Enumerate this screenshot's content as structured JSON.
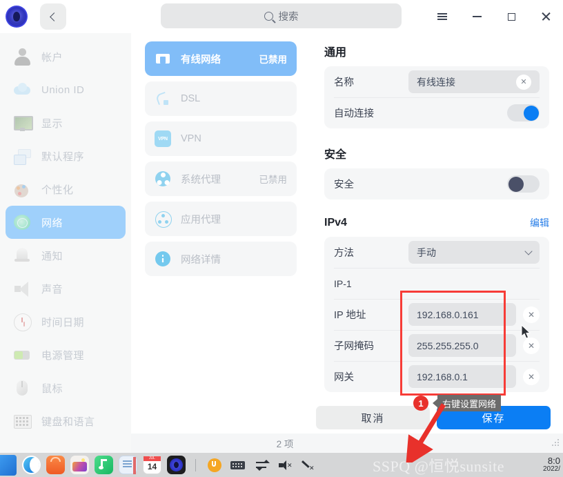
{
  "titlebar": {
    "back_tooltip": "返回",
    "search_placeholder": "搜索",
    "menu_icon": "hamburger-menu-icon",
    "minimize_icon": "minimize-icon",
    "maximize_icon": "maximize-icon",
    "close_icon": "close-icon"
  },
  "sidebar": {
    "items": [
      {
        "label": "帐户",
        "icon": "account-icon",
        "active": false
      },
      {
        "label": "Union ID",
        "icon": "cloud-icon",
        "active": false
      },
      {
        "label": "显示",
        "icon": "display-icon",
        "active": false
      },
      {
        "label": "默认程序",
        "icon": "default-apps-icon",
        "active": false
      },
      {
        "label": "个性化",
        "icon": "personalization-icon",
        "active": false
      },
      {
        "label": "网络",
        "icon": "network-icon",
        "active": true
      },
      {
        "label": "通知",
        "icon": "bell-icon",
        "active": false
      },
      {
        "label": "声音",
        "icon": "speaker-icon",
        "active": false
      },
      {
        "label": "时间日期",
        "icon": "clock-icon",
        "active": false
      },
      {
        "label": "电源管理",
        "icon": "battery-icon",
        "active": false
      },
      {
        "label": "鼠标",
        "icon": "mouse-icon",
        "active": false
      },
      {
        "label": "键盘和语言",
        "icon": "keyboard-icon",
        "active": false
      }
    ]
  },
  "network_list": {
    "items": [
      {
        "label": "有线网络",
        "status": "已禁用",
        "icon": "wired-network-icon",
        "active": true
      },
      {
        "label": "DSL",
        "status": "",
        "icon": "dsl-icon",
        "active": false
      },
      {
        "label": "VPN",
        "status": "",
        "icon": "vpn-icon",
        "active": false
      },
      {
        "label": "系统代理",
        "status": "已禁用",
        "icon": "system-proxy-icon",
        "active": false
      },
      {
        "label": "应用代理",
        "status": "",
        "icon": "app-proxy-icon",
        "active": false
      },
      {
        "label": "网络详情",
        "status": "",
        "icon": "info-icon",
        "active": false
      }
    ]
  },
  "detail": {
    "general": {
      "title": "通用",
      "name_label": "名称",
      "name_value": "有线连接",
      "autoconnect_label": "自动连接",
      "autoconnect_on": true
    },
    "security": {
      "title": "安全",
      "security_label": "安全",
      "security_on": false
    },
    "ipv4": {
      "title": "IPv4",
      "edit_label": "编辑",
      "method_label": "方法",
      "method_value": "手动",
      "group_label": "IP-1",
      "ip_label": "IP 地址",
      "ip_value": "192.168.0.161",
      "netmask_label": "子网掩码",
      "netmask_value": "255.255.255.0",
      "gateway_label": "网关",
      "gateway_value": "192.168.0.1"
    }
  },
  "actions": {
    "cancel_label": "取消",
    "save_label": "保存"
  },
  "statusbar": {
    "count_text": "2 项"
  },
  "annotation": {
    "badge_number": "1",
    "tooltip_text": "右键设置网络",
    "box_color": "#f73c37",
    "badge_color": "#e8312b",
    "tooltip_bg": "#6b6b6b"
  },
  "taskbar": {
    "dock_icons": [
      "files-icon",
      "browser-icon",
      "app-store-icon",
      "gallery-icon",
      "music-icon",
      "notes-icon",
      "calendar-icon",
      "settings-icon"
    ],
    "calendar_day": "14",
    "calendar_month": "JUL",
    "tray_icons": [
      "union-icon",
      "keyboard-input-icon",
      "network-transfer-icon",
      "volume-mute-icon",
      "brush-icon"
    ],
    "clock_time": "8:0",
    "clock_date": "2022/",
    "watermark": "SSPQ @恒悦sunsite"
  },
  "colors": {
    "accent_blue": "#0b7ef4",
    "active_sidebar": "#9fd0fb",
    "active_list": "#81bdf8",
    "link_blue": "#2a7fe8"
  }
}
